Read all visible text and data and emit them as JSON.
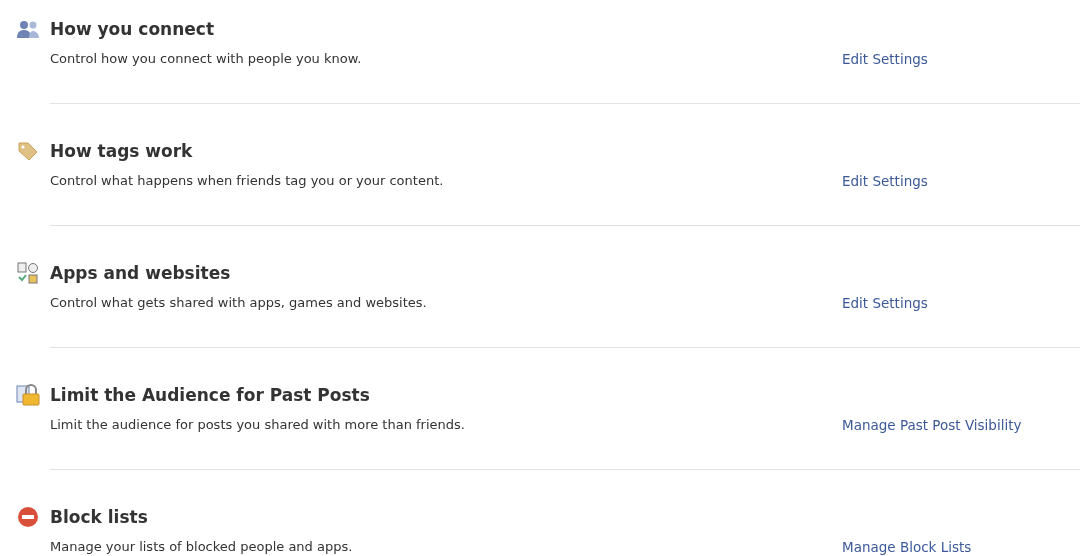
{
  "sections": [
    {
      "kind": "people",
      "title": "How you connect",
      "description": "Control how you connect with people you know.",
      "link": "Edit Settings"
    },
    {
      "kind": "tag",
      "title": "How tags work",
      "description": "Control what happens when friends tag you or your content.",
      "link": "Edit Settings"
    },
    {
      "kind": "apps",
      "title": "Apps and websites",
      "description": "Control what gets shared with apps, games and websites.",
      "link": "Edit Settings"
    },
    {
      "kind": "lock",
      "title": "Limit the Audience for Past Posts",
      "description": "Limit the audience for posts you shared with more than friends.",
      "link": "Manage Past Post Visibility"
    },
    {
      "kind": "block",
      "title": "Block lists",
      "description": "Manage your lists of blocked people and apps.",
      "link": "Manage Block Lists"
    }
  ]
}
